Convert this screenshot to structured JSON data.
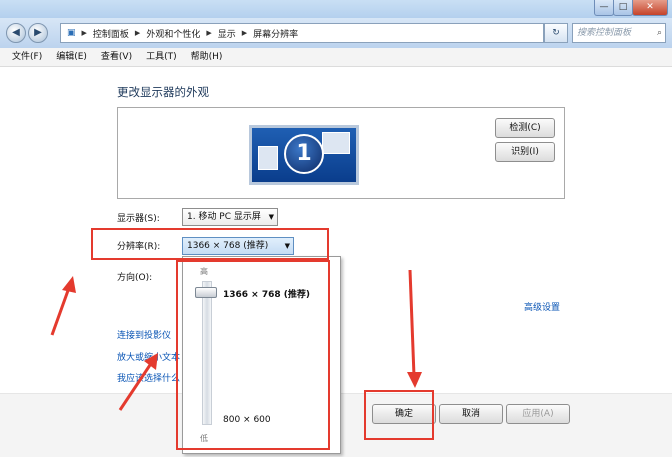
{
  "window": {
    "minimize_label": "—",
    "maximize_label": "□",
    "close_label": "✕"
  },
  "navigation": {
    "back_label": "◀",
    "forward_label": "▶",
    "breadcrumb": [
      "控制面板",
      "外观和个性化",
      "显示",
      "屏幕分辨率"
    ],
    "search_placeholder": "搜索控制面板",
    "refresh_label": "↻"
  },
  "menubar": {
    "items": [
      "文件(F)",
      "编辑(E)",
      "查看(V)",
      "工具(T)",
      "帮助(H)"
    ]
  },
  "main": {
    "title": "更改显示器的外观",
    "monitor_number": "1",
    "detect_label": "检测(C)",
    "identify_label": "识别(I)",
    "display_label": "显示器(S):",
    "display_value": "1. 移动 PC 显示屏",
    "resolution_label": "分辨率(R):",
    "resolution_value": "1366 × 768 (推荐)",
    "orientation_label": "方向(O):",
    "advanced_link": "高级设置",
    "links": [
      "连接到投影仪",
      "放大或缩小文本",
      "我应该选择什么"
    ]
  },
  "resolution_popup": {
    "high_label": "高",
    "low_label": "低",
    "top_option": "1366 × 768 (推荐)",
    "bottom_option": "800 × 600",
    "slider_level": 1.0
  },
  "footer": {
    "ok_label": "确定",
    "cancel_label": "取消",
    "apply_label": "应用(A)"
  },
  "annotations": {
    "color": "#e43a2e"
  }
}
